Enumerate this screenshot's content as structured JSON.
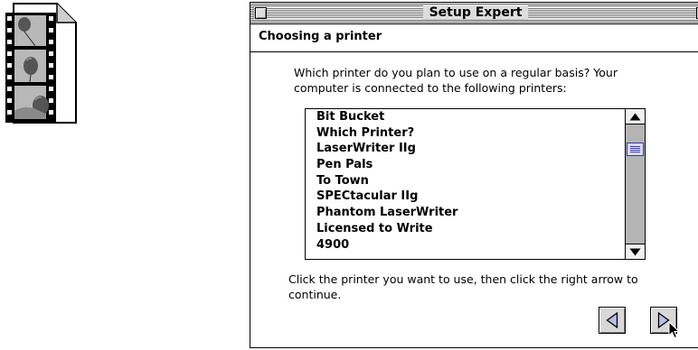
{
  "window": {
    "title": "Setup Expert"
  },
  "header": {
    "title": "Choosing a printer"
  },
  "prompt": {
    "line1": "Which printer do you plan to use on a regular basis? Your",
    "line2": "computer is connected to the following printers:"
  },
  "printers": {
    "items": [
      "Bit Bucket",
      "Which Printer?",
      "LaserWriter IIg",
      "Pen Pals",
      "To Town",
      "SPECtacular IIg",
      "Phantom LaserWriter",
      "Licensed to Write",
      "4900"
    ]
  },
  "instructions": {
    "line1": "Click the printer you want to use, then click the right arrow to",
    "line2": "continue."
  },
  "icons": {
    "document": "film-strip-document-icon",
    "close": "close-box-icon",
    "zoom": "zoom-box-icon",
    "scroll_up": "scroll-up-arrow-icon",
    "scroll_down": "scroll-down-arrow-icon",
    "previous": "left-triangle-icon",
    "next": "right-triangle-icon",
    "pointer": "arrow-cursor-icon"
  },
  "colors": {
    "accent": "#3b3b9c",
    "scroll_track": "#b4b4b4",
    "button_face": "#d8d8d8"
  }
}
